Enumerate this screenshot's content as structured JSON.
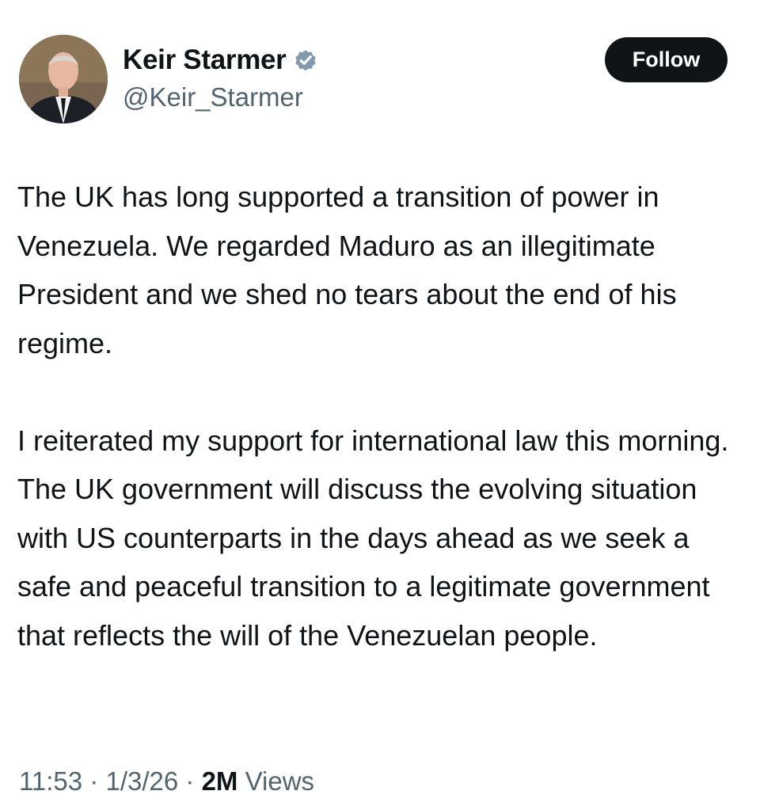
{
  "author": {
    "display_name": "Keir Starmer",
    "handle": "@Keir_Starmer",
    "verified": true,
    "verified_badge_color": "#829aab"
  },
  "follow_button": {
    "label": "Follow",
    "background": "#0f1419",
    "text_color": "#ffffff"
  },
  "tweet": {
    "paragraphs": [
      "The UK has long supported a transition of power in Venezuela. We regarded Maduro as an illegitimate President and we shed no tears about the end of his regime.",
      "I reiterated my support for international law this morning. The UK government will discuss the evolving situation with US counterparts in the days ahead as we seek a safe and peaceful transition to a legitimate government that reflects the will of the Venezuelan people."
    ]
  },
  "meta": {
    "time": "11:53",
    "separator": "·",
    "date": "1/3/26",
    "views_count": "2M",
    "views_label": "Views"
  },
  "icons": {
    "avatar": "profile-photo",
    "verified": "verified-badge-icon"
  }
}
